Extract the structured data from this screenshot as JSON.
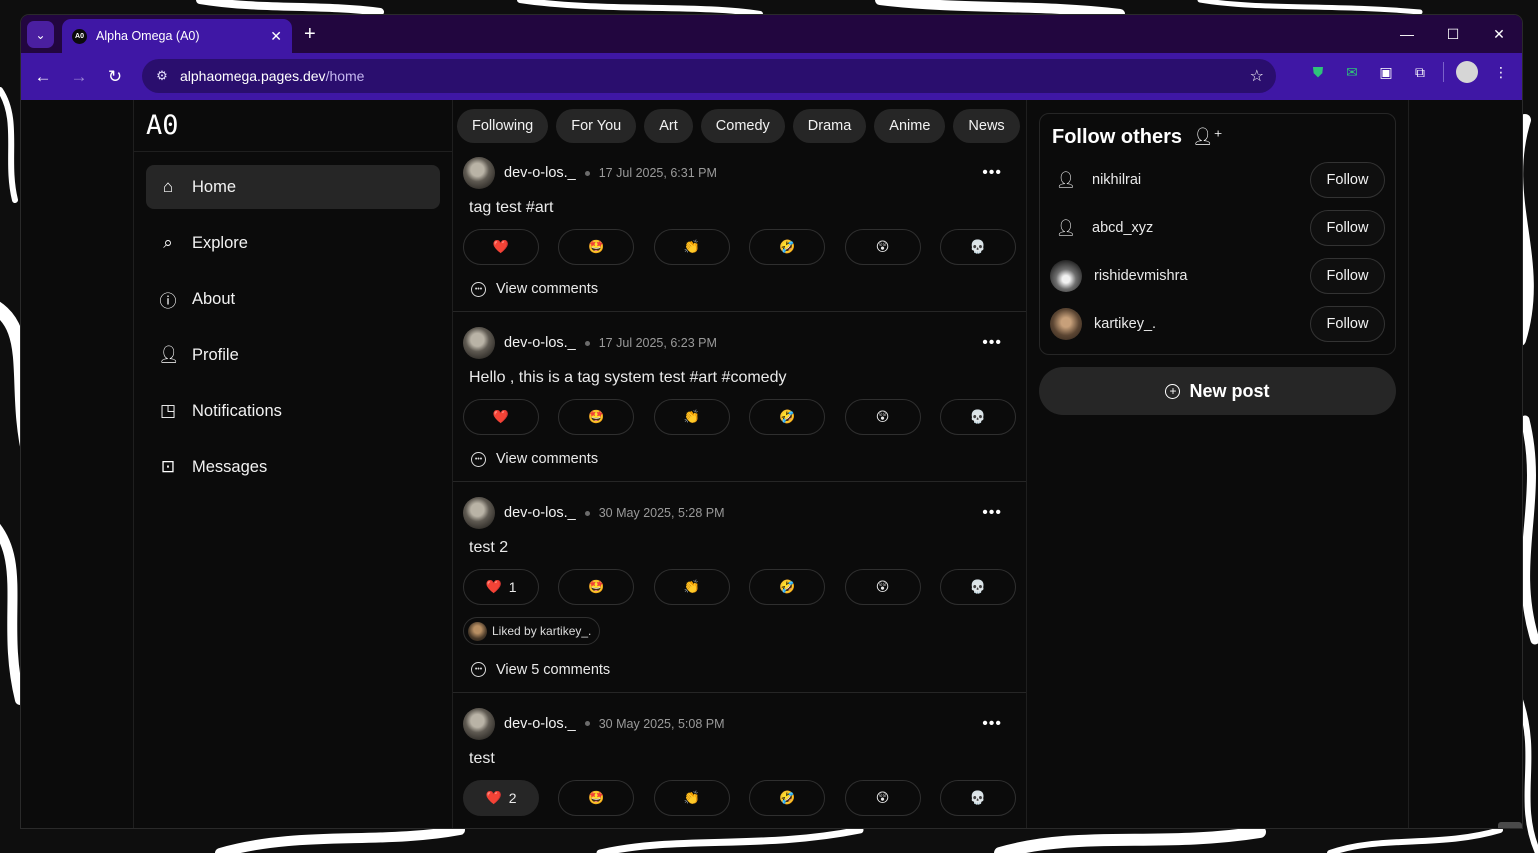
{
  "browser": {
    "tab_title": "Alpha Omega (A0)",
    "favicon_text": "A0",
    "url_host": "alphaomega.pages.dev",
    "url_path": "/home"
  },
  "sidebar": {
    "logo": "A0",
    "items": [
      {
        "label": "Home",
        "icon": "home-icon"
      },
      {
        "label": "Explore",
        "icon": "search-icon"
      },
      {
        "label": "About",
        "icon": "info-icon"
      },
      {
        "label": "Profile",
        "icon": "user-icon"
      },
      {
        "label": "Notifications",
        "icon": "bell-icon"
      },
      {
        "label": "Messages",
        "icon": "message-icon"
      }
    ]
  },
  "feed": {
    "chips": [
      "Following",
      "For You",
      "Art",
      "Comedy",
      "Drama",
      "Anime",
      "News"
    ],
    "posts": [
      {
        "user": "dev-o-los._",
        "time": "17 Jul 2025, 6:31 PM",
        "text": "tag test #art",
        "heart_count": "",
        "liked_by": "",
        "comments": "View comments"
      },
      {
        "user": "dev-o-los._",
        "time": "17 Jul 2025, 6:23 PM",
        "text": "Hello , this is a tag system test #art #comedy",
        "heart_count": "",
        "liked_by": "",
        "comments": "View comments"
      },
      {
        "user": "dev-o-los._",
        "time": "30 May 2025, 5:28 PM",
        "text": "test 2",
        "heart_count": "1",
        "liked_by": "Liked by kartikey_.",
        "comments": "View 5 comments"
      },
      {
        "user": "dev-o-los._",
        "time": "30 May 2025, 5:08 PM",
        "text": "test",
        "heart_count": "2",
        "liked_by": "",
        "comments": ""
      }
    ],
    "reactions": [
      "❤️",
      "🤩",
      "👏",
      "🤣",
      "😲",
      "💀"
    ]
  },
  "right": {
    "follow_title": "Follow others",
    "users": [
      {
        "name": "nikhilrai",
        "button": "Follow"
      },
      {
        "name": "abcd_xyz",
        "button": "Follow"
      },
      {
        "name": "rishidevmishra",
        "button": "Follow"
      },
      {
        "name": "kartikey_.",
        "button": "Follow"
      }
    ],
    "new_post": "New post"
  }
}
